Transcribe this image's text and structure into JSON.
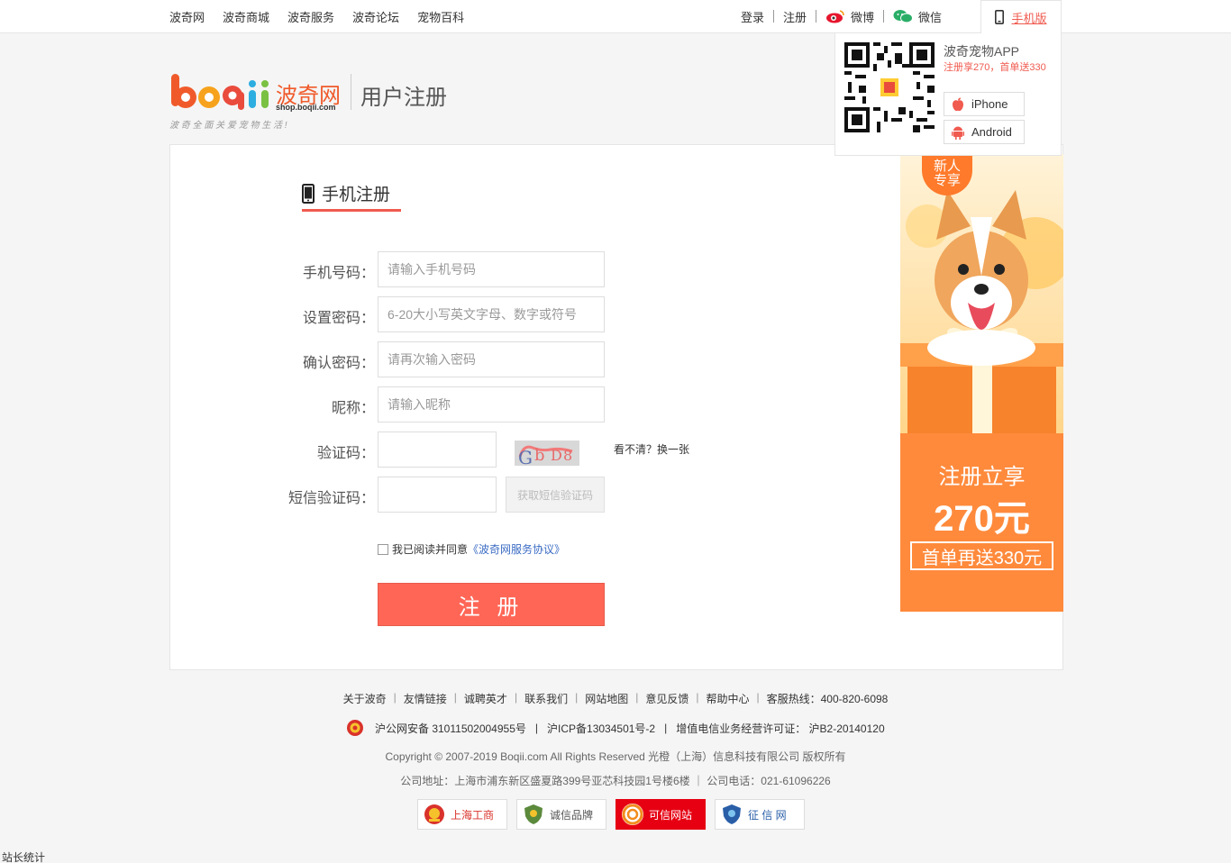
{
  "topnav": [
    "波奇网",
    "波奇商城",
    "波奇服务",
    "波奇论坛",
    "宠物百科"
  ],
  "topright": {
    "login": "登录",
    "register": "注册",
    "weibo": "微博",
    "wechat": "微信",
    "mobile": "手机版"
  },
  "app_dropdown": {
    "title": "波奇宠物APP",
    "promo": "注册享270，首单送330",
    "iphone": "iPhone",
    "android": "Android"
  },
  "header": {
    "logo_cn": "波奇网",
    "logo_domain": "shop.boqii.com",
    "slogan": "波 奇 全 面 关 爱 宠 物 生 活 !",
    "title": "用户注册"
  },
  "form": {
    "tab": "手机注册",
    "phone_label": "手机号码：",
    "phone_placeholder": "请输入手机号码",
    "pwd_label": "设置密码：",
    "pwd_placeholder": "6-20大小写英文字母、数字或符号",
    "confirm_label": "确认密码：",
    "confirm_placeholder": "请再次输入密码",
    "nick_label": "昵称：",
    "nick_placeholder": "请输入昵称",
    "captcha_label": "验证码：",
    "captcha_refresh": "看不清？换一张",
    "sms_label": "短信验证码：",
    "sms_button": "获取短信验证码",
    "agree_text": "我已阅读并同意",
    "agree_link": "《波奇网服务协议》",
    "submit": "注 册"
  },
  "banner": {
    "badge": "新人\n专享",
    "line1": "注册立享",
    "line2": "270元",
    "line3": "首单再送330元"
  },
  "footer": {
    "links": [
      "关于波奇",
      "友情链接",
      "诚聘英才",
      "联系我们",
      "网站地图",
      "意见反馈",
      "帮助中心",
      "客服热线：400-820-6098"
    ],
    "police": "沪公网安备 31011502004955号",
    "icp": "沪ICP备13034501号-2",
    "license": "增值电信业务经营许可证： 沪B2-20140120",
    "copyright": "Copyright © 2007-2019 Boqii.com All Rights Reserved 光橙（上海）信息科技有限公司 版权所有",
    "address": "公司地址：上海市浦东新区盛夏路399号亚芯科技园1号楼6楼 ｜ 公司电话：021-61096226",
    "badges": [
      "上海工商",
      "诚信品牌",
      "可信网站",
      "征 信 网"
    ]
  },
  "stat": "站长统计",
  "colors": {
    "accent": "#f05a4f",
    "submit": "#ff6656",
    "banner": "#ff8a3c"
  }
}
